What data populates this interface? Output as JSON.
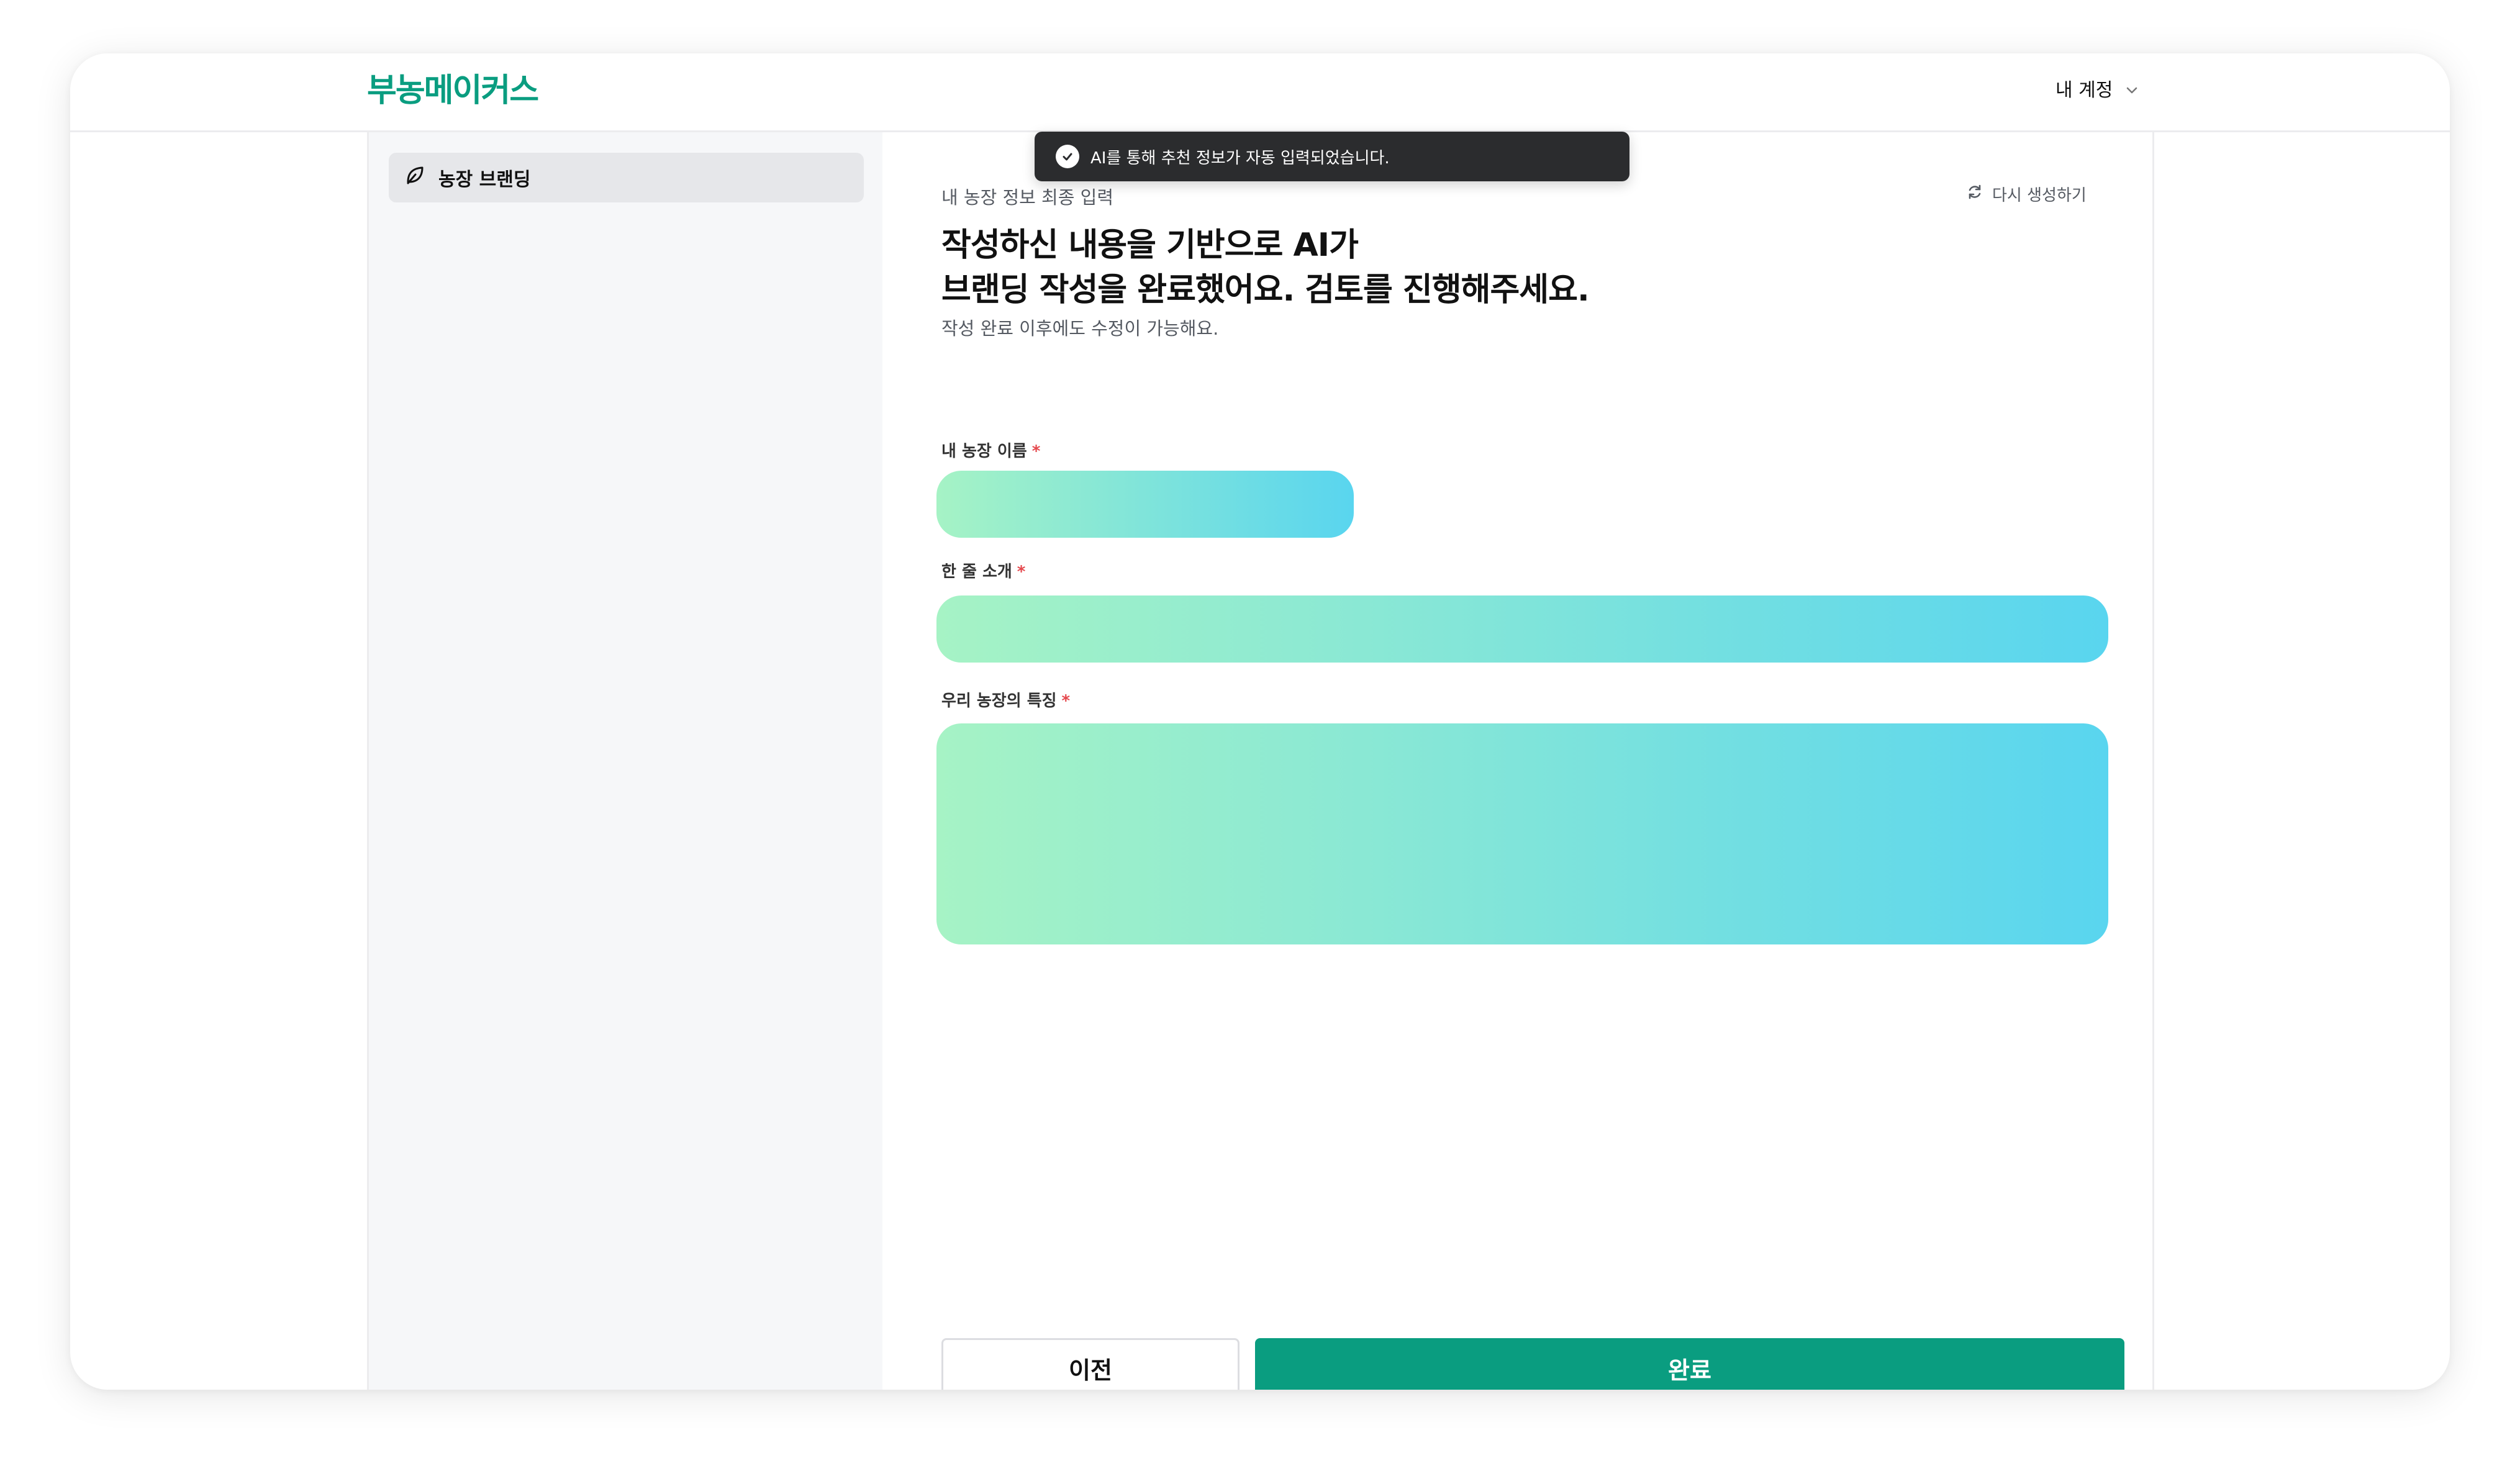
{
  "header": {
    "logo": "부농메이커스",
    "account_label": "내 계정"
  },
  "toast": {
    "message": "AI를 통해 추천 정보가 자동 입력되었습니다."
  },
  "sidebar": {
    "items": [
      {
        "label": "농장 브랜딩",
        "icon": "leaf-icon",
        "active": true
      }
    ]
  },
  "main": {
    "eyebrow": "내 농장 정보 최종 입력",
    "regenerate_label": "다시 생성하기",
    "headline_line1": "작성하신 내용을 기반으로 AI가",
    "headline_line2": "브랜딩 작성을 완료했어요. 검토를 진행해주세요.",
    "subline": "작성 완료 이후에도 수정이 가능해요.",
    "fields": {
      "farm_name": {
        "label": "내 농장 이름",
        "required_mark": "*",
        "value": ""
      },
      "one_line_intro": {
        "label": "한 줄 소개",
        "required_mark": "*",
        "value": ""
      },
      "farm_features": {
        "label": "우리 농장의 특징",
        "required_mark": "*",
        "value": ""
      }
    },
    "buttons": {
      "prev": "이전",
      "done": "완료"
    }
  },
  "colors": {
    "brand": "#0a9d80",
    "field_gradient_start": "#a6f3c5",
    "field_gradient_end": "#59d5ef",
    "toast_bg": "#2b2c2e",
    "required": "#e5484d"
  }
}
